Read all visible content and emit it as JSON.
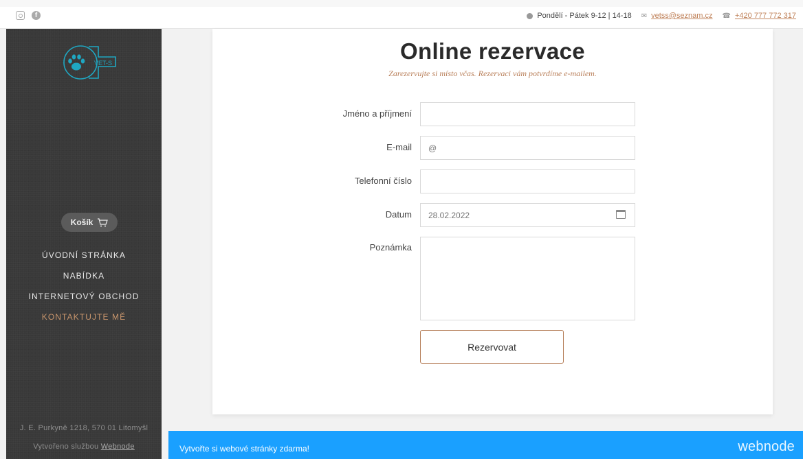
{
  "topbar": {
    "social": [
      {
        "icon": "instagram-icon"
      },
      {
        "icon": "facebook-icon"
      }
    ],
    "hours": "Pondělí - Pátek 9-12 | 14-18",
    "email": "vetss@seznam.cz",
    "phone": "+420 777 772 317"
  },
  "sidebar": {
    "logo_text": "VET-S",
    "cart_label": "Košík",
    "nav": [
      {
        "label": "ÚVODNÍ STRÁNKA",
        "active": false
      },
      {
        "label": "NABÍDKA",
        "active": false
      },
      {
        "label": "INTERNETOVÝ OBCHOD",
        "active": false
      },
      {
        "label": "KONTAKTUJTE MĚ",
        "active": true
      }
    ],
    "address": "J. E. Purkyně 1218, 570 01 Litomyšl",
    "made_by_prefix": "Vytvořeno službou",
    "made_by_link": "Webnode"
  },
  "form": {
    "title": "Online rezervace",
    "subtitle": "Zarezervujte si místo včas. Rezervaci vám potvrdíme e-mailem.",
    "fields": {
      "name": {
        "label": "Jméno a příjmení",
        "placeholder": ""
      },
      "email": {
        "label": "E-mail",
        "placeholder": "@"
      },
      "phone": {
        "label": "Telefonní číslo",
        "placeholder": ""
      },
      "date": {
        "label": "Datum",
        "placeholder": "28.02.2022"
      },
      "note": {
        "label": "Poznámka",
        "placeholder": ""
      }
    },
    "submit_label": "Rezervovat"
  },
  "banner": {
    "text": "Vytvořte si webové stránky zdarma!",
    "brand": "webnode"
  },
  "colors": {
    "accent": "#c0825a",
    "sidebar_bg": "#393939",
    "banner_bg": "#1aa0ff",
    "logo": "#1fa7c2"
  }
}
